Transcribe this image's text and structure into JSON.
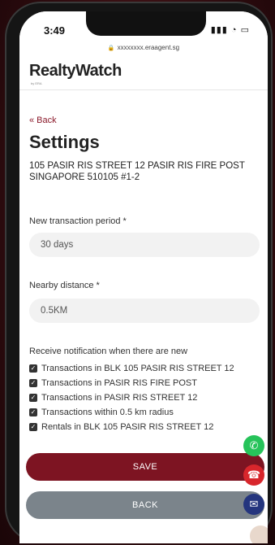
{
  "status": {
    "time": "3:49",
    "icons": "▮▮▮ ◔ ▭"
  },
  "url": {
    "lock_icon": "lock-icon",
    "text": "xxxxxxxx.eraagent.sg"
  },
  "brand": {
    "logo": "RealtyWatch",
    "sub": "by ERA"
  },
  "nav": {
    "back_link": "« Back"
  },
  "page": {
    "title": "Settings",
    "address": "105 PASIR RIS STREET 12 PASIR RIS FIRE POST SINGAPORE 510105 #1-2"
  },
  "form": {
    "period_label": "New transaction period *",
    "period_value": "30 days",
    "distance_label": "Nearby distance *",
    "distance_value": "0.5KM",
    "notif_label": "Receive notification when there are new",
    "options": [
      {
        "label": "Transactions in BLK 105 PASIR RIS STREET 12",
        "checked": true
      },
      {
        "label": "Transactions in PASIR RIS FIRE POST",
        "checked": true
      },
      {
        "label": "Transactions in PASIR RIS STREET 12",
        "checked": true
      },
      {
        "label": "Transactions within 0.5 km radius",
        "checked": true
      },
      {
        "label": "Rentals in BLK 105 PASIR RIS STREET 12",
        "checked": true
      }
    ]
  },
  "buttons": {
    "save": "SAVE",
    "back": "BACK"
  },
  "fabs": {
    "whatsapp_icon": "whatsapp-icon",
    "phone_icon": "phone-icon",
    "mail_icon": "mail-icon"
  },
  "colors": {
    "accent": "#7d1422",
    "back_button": "#7b848b",
    "whatsapp": "#26c35a",
    "phone": "#d8262c",
    "mail": "#24357e"
  }
}
